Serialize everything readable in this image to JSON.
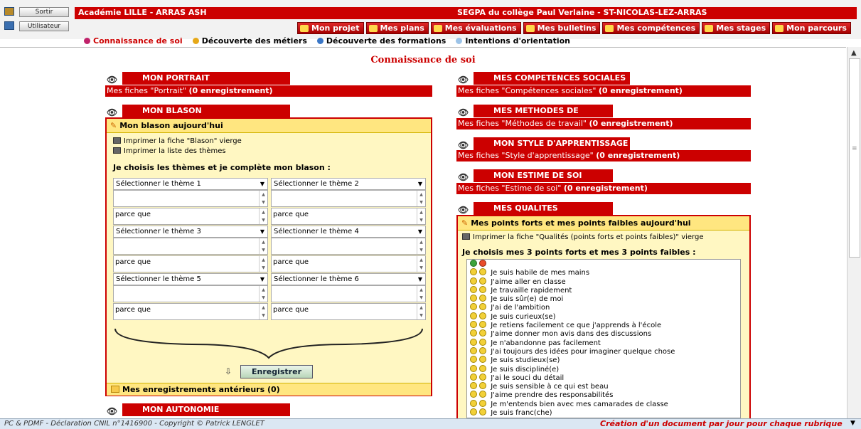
{
  "header": {
    "sortir_label": "Sortir",
    "utilisateur_label": "Utilisateur",
    "academie": "Académie LILLE - ARRAS ASH",
    "etablissement": "SEGPA du collège Paul Verlaine - ST-NICOLAS-LEZ-ARRAS"
  },
  "nav_tabs": [
    "Mon projet",
    "Mes plans",
    "Mes évaluations",
    "Mes bulletins",
    "Mes compétences",
    "Mes stages",
    "Mon parcours"
  ],
  "sub_tabs": [
    "Connaissance de soi",
    "Découverte des métiers",
    "Découverte des formations",
    "Intentions d'orientation"
  ],
  "page_title": "Connaissance de soi",
  "left": {
    "portrait": {
      "title": "MON PORTRAIT",
      "fiches": "Mes fiches \"Portrait\"",
      "count": "(0 enregistrement)"
    },
    "blason": {
      "title": "MON BLASON",
      "box_title": "Mon blason aujourd'hui",
      "print1": "Imprimer la fiche \"Blason\" vierge",
      "print2": "Imprimer la liste des thèmes",
      "choose": "Je choisis les thèmes et je complète mon blason :",
      "themes": [
        "Sélectionner le thème 1",
        "Sélectionner le thème 2",
        "Sélectionner le thème 3",
        "Sélectionner le thème 4",
        "Sélectionner le thème 5",
        "Sélectionner le thème 6"
      ],
      "parce_que": "parce que",
      "save": "Enregistrer",
      "previous": "Mes enregistrements antérieurs (0)"
    },
    "autonomie": {
      "title": "MON AUTONOMIE"
    }
  },
  "right": {
    "sections": [
      {
        "title": "MES COMPETENCES SOCIALES",
        "fiches": "Mes fiches \"Compétences sociales\"",
        "count": "(0 enregistrement)"
      },
      {
        "title": "MES METHODES DE TRAVAIL",
        "fiches": "Mes fiches \"Méthodes de travail\"",
        "count": "(0 enregistrement)"
      },
      {
        "title": "MON STYLE D'APPRENTISSAGE",
        "fiches": "Mes fiches \"Style d'apprentissage\"",
        "count": "(0 enregistrement)"
      },
      {
        "title": "MON ESTIME DE SOI",
        "fiches": "Mes fiches \"Estime de soi\"",
        "count": "(0 enregistrement)"
      }
    ],
    "qualites": {
      "title": "MES QUALITES",
      "box_title": "Mes points forts et mes points faibles aujourd'hui",
      "print": "Imprimer la fiche \"Qualités (points forts et points faibles)\" vierge",
      "choose": "Je choisis mes 3 points forts et mes 3 points faibles :",
      "items": [
        "Je suis habile de mes mains",
        "J'aime aller en classe",
        "Je travaille rapidement",
        "Je suis sûr(e) de moi",
        "J'ai de l'ambition",
        "Je suis curieux(se)",
        "Je retiens facilement ce que j'apprends à l'école",
        "J'aime donner mon avis dans des discussions",
        "Je n'abandonne pas facilement",
        "J'ai toujours des idées pour imaginer quelque chose",
        "Je suis studieux(se)",
        "Je suis discipliné(e)",
        "J'ai le souci du détail",
        "Je suis sensible à ce qui est beau",
        "J'aime prendre des responsabilités",
        "Je m'entends bien avec mes camarades de classe",
        "Je suis franc(che)"
      ]
    }
  },
  "footer": {
    "left": "PC & PDMF - Déclaration CNIL n°1416900 - Copyright © Patrick LENGLET",
    "right": "Création d'un document par jour pour chaque rubrique"
  },
  "colors": {
    "accent": "#cc0000",
    "box_bg": "#fff7c2"
  }
}
